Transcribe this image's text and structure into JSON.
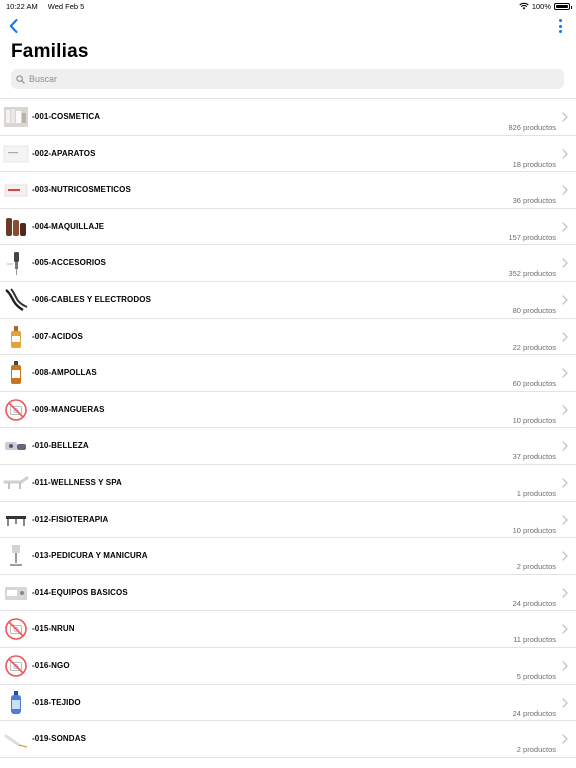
{
  "status": {
    "time": "10:22 AM",
    "date": "Wed Feb 5",
    "battery": "100%"
  },
  "header": {
    "title": "Familias"
  },
  "search": {
    "placeholder": "Buscar",
    "value": ""
  },
  "families": [
    {
      "name": "-001-COSMETICA",
      "count": "826 productos",
      "thumb": "cosmetics-thumb"
    },
    {
      "name": "-002-APARATOS",
      "count": "18 productos",
      "thumb": "device-box-thumb"
    },
    {
      "name": "-003-NUTRICOSMETICOS",
      "count": "36 productos",
      "thumb": "nutri-box-thumb"
    },
    {
      "name": "-004-MAQUILLAJE",
      "count": "157 productos",
      "thumb": "makeup-thumb"
    },
    {
      "name": "-005-ACCESORIOS",
      "count": "352 productos",
      "thumb": "accessory-thumb"
    },
    {
      "name": "-006-CABLES Y ELECTRODOS",
      "count": "80 productos",
      "thumb": "cables-thumb"
    },
    {
      "name": "-007-ACIDOS",
      "count": "22 productos",
      "thumb": "acid-bottle-thumb"
    },
    {
      "name": "-008-AMPOLLAS",
      "count": "60 productos",
      "thumb": "ampoule-box-thumb"
    },
    {
      "name": "-009-MANGUERAS",
      "count": "10 productos",
      "thumb": "no-image-thumb"
    },
    {
      "name": "-010-BELLEZA",
      "count": "37 productos",
      "thumb": "beauty-device-thumb"
    },
    {
      "name": "-011-WELLNESS Y SPA",
      "count": "1 productos",
      "thumb": "spa-bed-thumb"
    },
    {
      "name": "-012-FISIOTERAPIA",
      "count": "10 productos",
      "thumb": "physio-table-thumb"
    },
    {
      "name": "-013-PEDICURA Y MANICURA",
      "count": "2 productos",
      "thumb": "pedicure-cart-thumb"
    },
    {
      "name": "-014-EQUIPOS BASICOS",
      "count": "24 productos",
      "thumb": "basic-equipment-thumb"
    },
    {
      "name": "-015-NRUN",
      "count": "11 productos",
      "thumb": "no-image-thumb"
    },
    {
      "name": "-016-NGO",
      "count": "5 productos",
      "thumb": "no-image-thumb"
    },
    {
      "name": "-018-TEJIDO",
      "count": "24 productos",
      "thumb": "spray-bottle-thumb"
    },
    {
      "name": "-019-SONDAS",
      "count": "2 productos",
      "thumb": "probe-thumb"
    }
  ],
  "colors": {
    "accent": "#1a73e8",
    "divider": "#e2e2e5",
    "secondary_text": "#6e6e73",
    "search_bg": "#efeff1"
  }
}
